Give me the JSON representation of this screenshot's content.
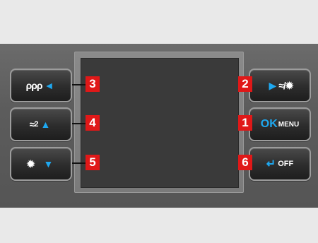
{
  "buttons": {
    "left": [
      {
        "icon": "wavy-arrows-icon",
        "glyph": "ρρρ",
        "arrow": "◄",
        "number": "3"
      },
      {
        "icon": "seat-heat-2-icon",
        "glyph": "≈",
        "suffix": "2",
        "arrow": "▲",
        "number": "4"
      },
      {
        "icon": "sun-icon",
        "glyph": "✹",
        "arrow": "▼",
        "number": "5"
      }
    ],
    "right": [
      {
        "icon": "heat-sun-icon",
        "arrow": "▶",
        "glyph": "≈/✹",
        "number": "2"
      },
      {
        "ok_label": "OK",
        "menu_label": "MENU",
        "number": "1"
      },
      {
        "icon": "return-arrow-icon",
        "glyph": "↵",
        "off_label": "OFF",
        "number": "6"
      }
    ]
  },
  "colors": {
    "accent": "#1ea8f0",
    "badge": "#e01818"
  }
}
